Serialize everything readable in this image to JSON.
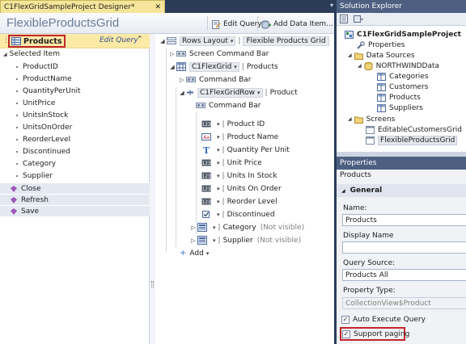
{
  "doc_tab": {
    "title": "C1FlexGridSampleProject Designer*",
    "close": "✕"
  },
  "right_tabstrip": {
    "menu": "▾"
  },
  "designer": {
    "title": "FlexibleProductsGrid",
    "edit_query_label": "Edit Query",
    "add_data_item_label": "Add Data Item..."
  },
  "list_pane": {
    "entity": "Products",
    "edit_query_link": "Edit Query",
    "selected_item": "Selected Item",
    "fields": [
      "ProductID",
      "ProductName",
      "QuantityPerUnit",
      "UnitPrice",
      "UnitsInStock",
      "UnitsOnOrder",
      "ReorderLevel",
      "Discontinued",
      "Category",
      "Supplier"
    ],
    "commands": [
      "Close",
      "Refresh",
      "Save"
    ]
  },
  "tree": {
    "rows_layout": "Rows Layout",
    "root_name": "Flexible Products Grid",
    "screen_command_bar": "Screen Command Bar",
    "grid_type": "C1FlexGrid",
    "grid_collection": "Products",
    "grid_command_bar": "Command Bar",
    "row_type": "C1FlexGridRow",
    "row_entity": "Product",
    "row_command_bar": "Command Bar",
    "columns": [
      {
        "label": "Product ID",
        "icon": "number-icon"
      },
      {
        "label": "Product Name",
        "icon": "text-icon"
      },
      {
        "label": "Quantity Per Unit",
        "icon": "text-t-icon"
      },
      {
        "label": "Unit Price",
        "icon": "number-icon"
      },
      {
        "label": "Units In Stock",
        "icon": "number-icon"
      },
      {
        "label": "Units On Order",
        "icon": "number-icon"
      },
      {
        "label": "Reorder Level",
        "icon": "number-icon"
      },
      {
        "label": "Discontinued",
        "icon": "checkbox-icon"
      }
    ],
    "related": [
      {
        "label": "Category",
        "note": "(Not visible)"
      },
      {
        "label": "Supplier",
        "note": "(Not visible)"
      }
    ],
    "add_label": "Add"
  },
  "solution_explorer": {
    "title": "Solution Explorer",
    "project": "C1FlexGridSampleProject",
    "properties": "Properties",
    "data_sources": "Data Sources",
    "data_source_name": "NORTHWINDData",
    "tables": [
      "Categories",
      "Customers",
      "Products",
      "Suppliers"
    ],
    "screens_folder": "Screens",
    "screens": [
      "EditableCustomersGrid",
      "FlexibleProductsGrid"
    ]
  },
  "properties": {
    "title": "Properties",
    "selected_object": "Products",
    "section": "General",
    "name_label": "Name:",
    "name_value": "Products",
    "display_name_label": "Display Name",
    "display_name_value": "",
    "query_source_label": "Query Source:",
    "query_source_value": "Products All",
    "property_type_label": "Property Type:",
    "property_type_value": "CollectionView$Product",
    "auto_execute_label": "Auto Execute Query",
    "auto_execute_checked": true,
    "support_paging_label": "Support paging",
    "support_paging_checked": true
  },
  "colors": {
    "tab_active": "#f4e59a",
    "selection_highlight": "#fbe9a6",
    "callout_red": "#c0262d",
    "panel_title": "#4d6082",
    "background": "#2b3c59"
  }
}
